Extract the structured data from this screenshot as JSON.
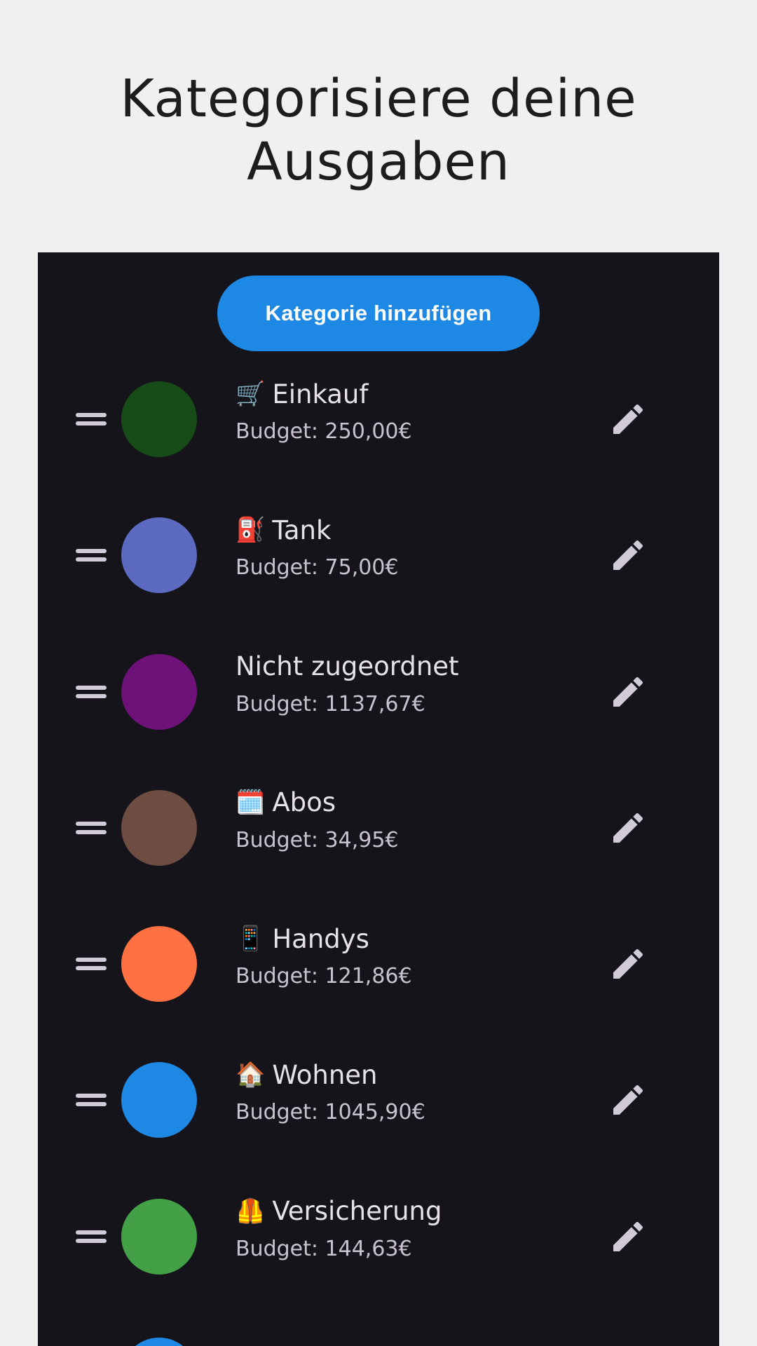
{
  "page": {
    "heading": "Kategorisiere deine Ausgaben"
  },
  "toolbar": {
    "add_label": "Kategorie hinzufügen",
    "add_color": "#1e88e5"
  },
  "categories": [
    {
      "emoji": "🛒",
      "name": "Einkauf",
      "budget": "Budget: 250,00€",
      "color": "#174b17",
      "icon": "shopping-cart-icon"
    },
    {
      "emoji": "⛽",
      "name": "Tank",
      "budget": "Budget: 75,00€",
      "color": "#5c6bc0",
      "icon": "fuel-pump-icon"
    },
    {
      "emoji": "",
      "name": "Nicht zugeordnet",
      "budget": "Budget: 1137,67€",
      "color": "#6e127a",
      "icon": ""
    },
    {
      "emoji": "🗓️",
      "name": "Abos",
      "budget": "Budget: 34,95€",
      "color": "#6d4c41",
      "icon": "calendar-icon"
    },
    {
      "emoji": "📱",
      "name": "Handys",
      "budget": "Budget: 121,86€",
      "color": "#ff7043",
      "icon": "phone-icon"
    },
    {
      "emoji": "🏠",
      "name": "Wohnen",
      "budget": "Budget: 1045,90€",
      "color": "#1e88e5",
      "icon": "house-icon"
    },
    {
      "emoji": "🦺",
      "name": "Versicherung",
      "budget": "Budget: 144,63€",
      "color": "#43a047",
      "icon": "safety-vest-icon"
    }
  ],
  "peek_color": "#1e88e5",
  "colors": {
    "background": "#f0f0f0",
    "panel": "#15141a",
    "text_primary": "#e7e1ea",
    "text_secondary": "#c9c3cf",
    "icon": "#d0cbd6"
  }
}
